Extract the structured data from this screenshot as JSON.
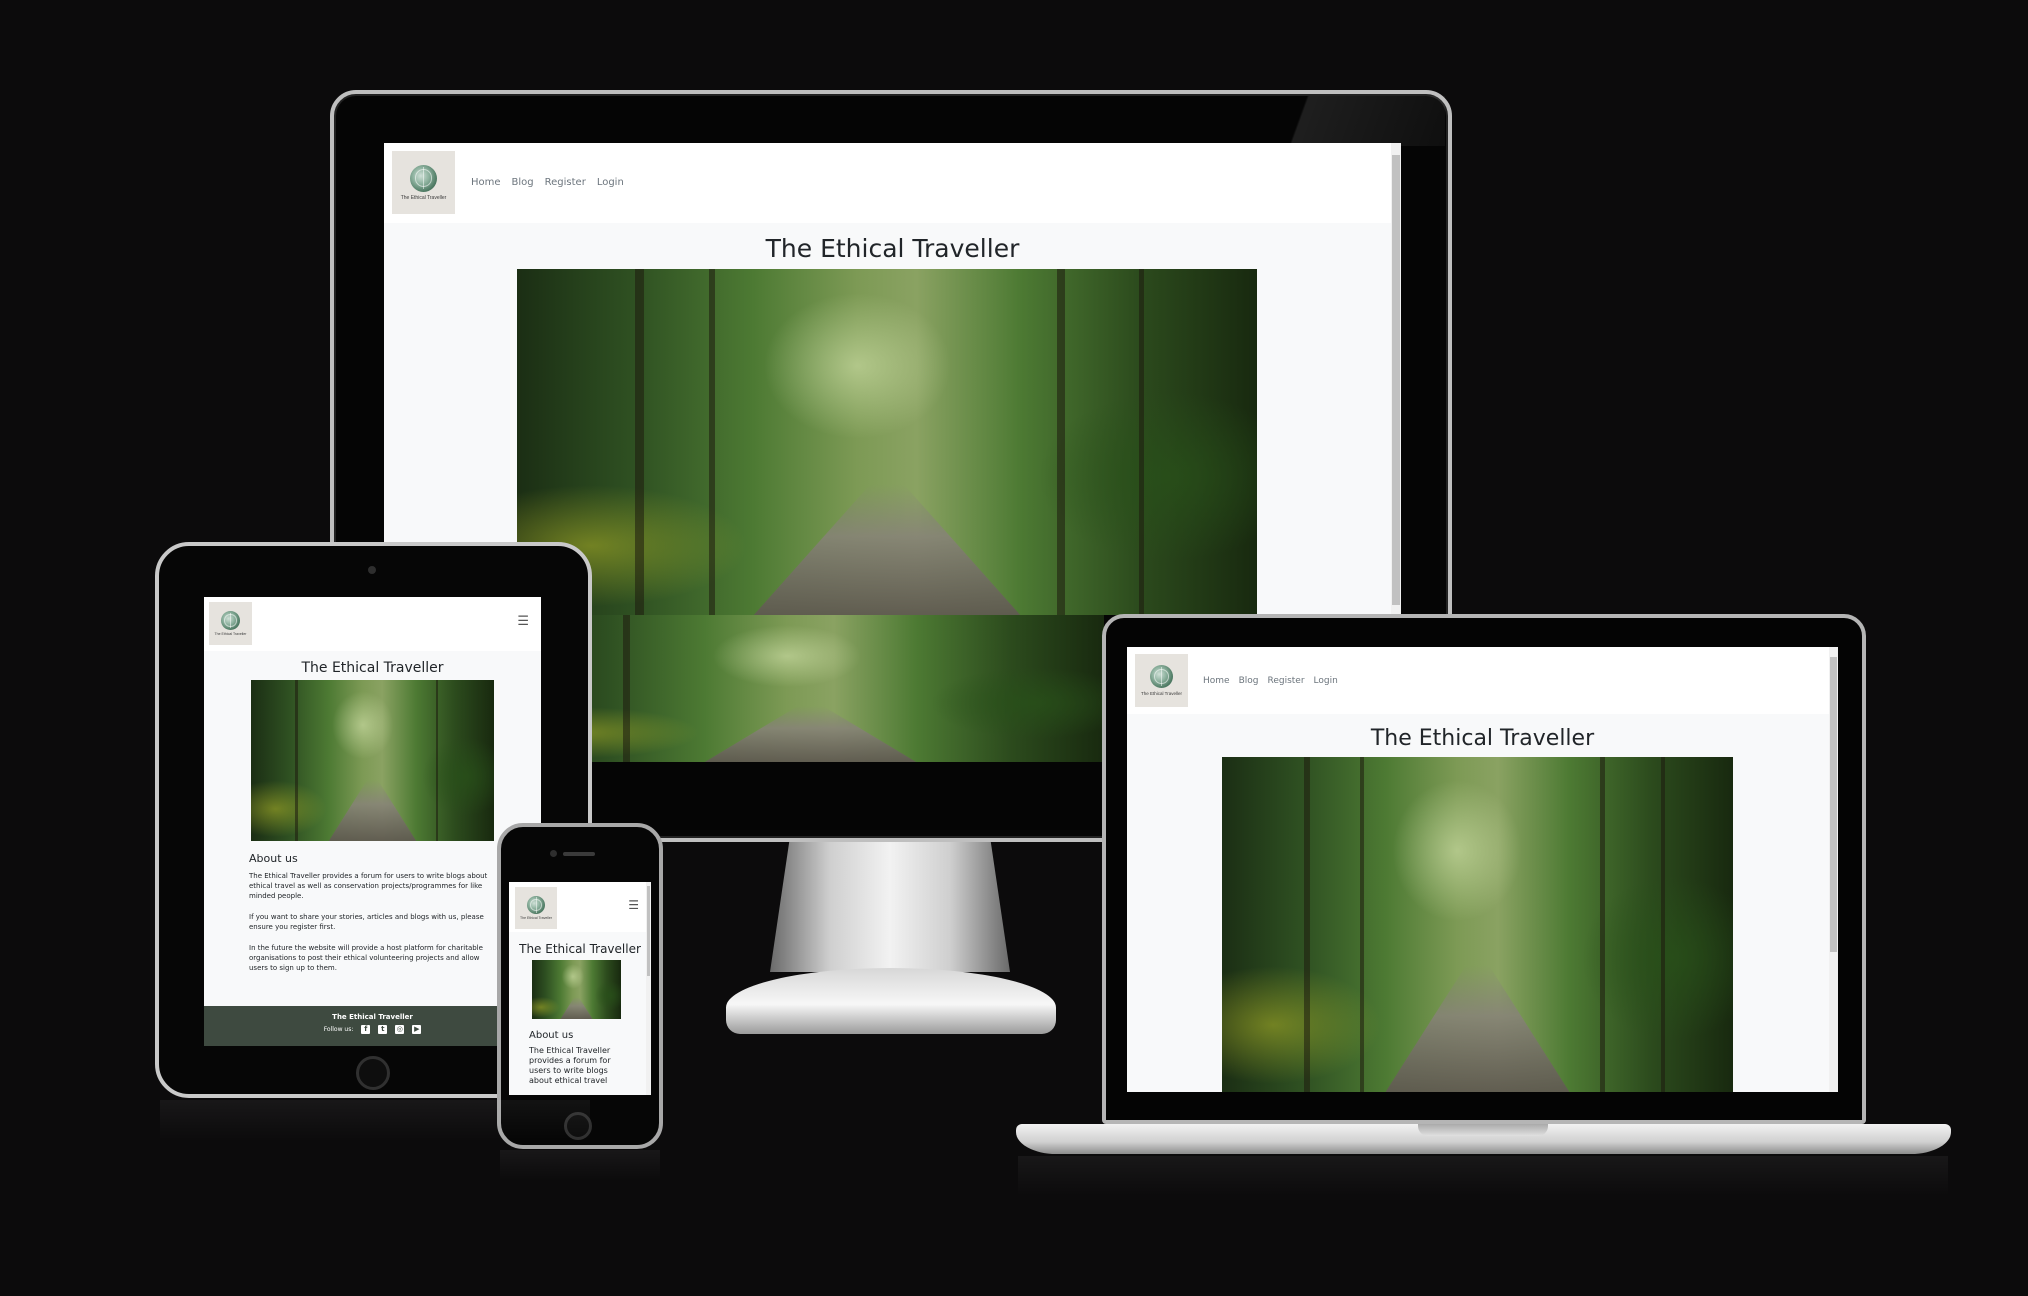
{
  "site": {
    "logo_text": "The Ethical Traveller",
    "title": "The Ethical Traveller",
    "nav": [
      "Home",
      "Blog",
      "Register",
      "Login"
    ],
    "menu_icon": "hamburger-icon",
    "about_heading": "About us",
    "about_paragraphs": [
      "The Ethical Traveller provides a forum for users to write blogs about ethical travel as well as conservation projects/programmes for like minded people.",
      "If you want to share your stories, articles and blogs with us, please ensure you register first.",
      "In the future the website will provide a host platform for charitable organisations to post their ethical volunteering projects and allow users to sign up to them."
    ],
    "phone_about_text": "The Ethical Traveller provides a forum for users to write blogs about ethical travel",
    "footer_title": "The Ethical Traveller",
    "footer_follow": "Follow us:",
    "social_icons": [
      "facebook-icon",
      "twitter-icon",
      "instagram-icon",
      "youtube-icon"
    ]
  },
  "colors": {
    "page_bg": "#0c0b0c",
    "site_bg": "#f8f9fa",
    "footer_bg": "#3e4a40",
    "nav_text": "#6c757d"
  }
}
